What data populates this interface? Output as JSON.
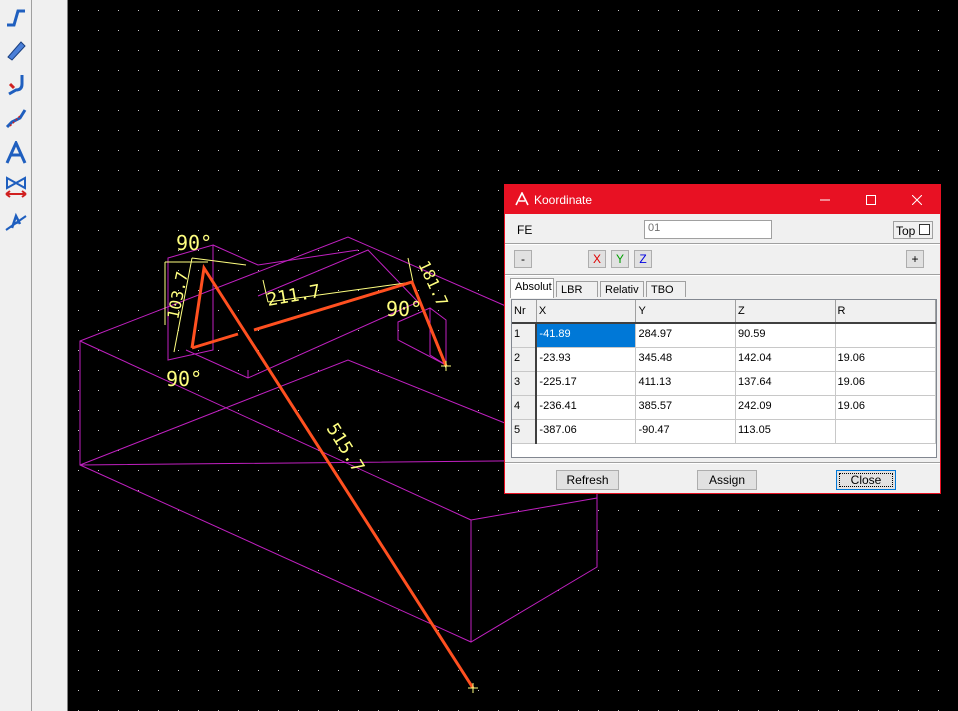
{
  "toolbar": {
    "tools": [
      {
        "icon": "pipe-route-icon"
      },
      {
        "icon": "pipe-segment-icon"
      },
      {
        "icon": "pipe-bend-icon"
      },
      {
        "icon": "pipe-slope-icon"
      },
      {
        "icon": "text-annotation-icon"
      },
      {
        "icon": "valve-dimension-icon"
      },
      {
        "icon": "dimension-text-icon"
      }
    ]
  },
  "drawing": {
    "labels": {
      "angle_top": "90°",
      "angle_bottom": "90°",
      "angle_right": "90°",
      "len_left": "103.7",
      "len_middle": "211.7",
      "len_right": "181.7",
      "len_long": "515.7"
    },
    "colors": {
      "box": "#c020c0",
      "pipe": "#ff5020",
      "dim": "#ffff80"
    }
  },
  "dialog": {
    "title": "Koordinate",
    "fe_label": "FE",
    "fe_value": "01",
    "top_label": "Top",
    "top_checked": false,
    "minus_label": "-",
    "plus_label": "+",
    "x_label": "X",
    "y_label": "Y",
    "z_label": "Z",
    "tabs": [
      "Absolut",
      "LBR",
      "Relativ",
      "TBO"
    ],
    "active_tab": "Absolut",
    "columns": [
      "Nr",
      "X",
      "Y",
      "Z",
      "R"
    ],
    "rows": [
      {
        "nr": "1",
        "x": "-41.89",
        "y": "284.97",
        "z": "90.59",
        "r": ""
      },
      {
        "nr": "2",
        "x": "-23.93",
        "y": "345.48",
        "z": "142.04",
        "r": "19.06"
      },
      {
        "nr": "3",
        "x": "-225.17",
        "y": "411.13",
        "z": "137.64",
        "r": "19.06"
      },
      {
        "nr": "4",
        "x": "-236.41",
        "y": "385.57",
        "z": "242.09",
        "r": "19.06"
      },
      {
        "nr": "5",
        "x": "-387.06",
        "y": "-90.47",
        "z": "113.05",
        "r": ""
      }
    ],
    "refresh_label": "Refresh",
    "assign_label": "Assign",
    "close_label": "Close"
  }
}
